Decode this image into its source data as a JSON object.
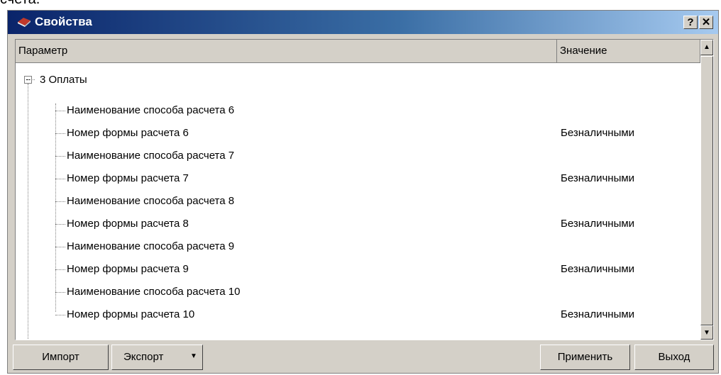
{
  "top_fragment": "счета.",
  "window": {
    "title": "Свойства"
  },
  "titlebar_buttons": {
    "help": "?",
    "close": "✕"
  },
  "columns": {
    "param": "Параметр",
    "value": "Значение"
  },
  "tree": {
    "root": "3 Оплаты",
    "rows": [
      {
        "name": "Наименование способа расчета 6",
        "value": ""
      },
      {
        "name": "Номер формы расчета 6",
        "value": "Безналичными"
      },
      {
        "name": "Наименование способа расчета 7",
        "value": ""
      },
      {
        "name": "Номер формы расчета 7",
        "value": "Безналичными"
      },
      {
        "name": "Наименование способа расчета 8",
        "value": ""
      },
      {
        "name": "Номер формы расчета 8",
        "value": "Безналичными"
      },
      {
        "name": "Наименование способа расчета 9",
        "value": ""
      },
      {
        "name": "Номер формы расчета 9",
        "value": "Безналичными"
      },
      {
        "name": "Наименование способа расчета 10",
        "value": ""
      },
      {
        "name": "Номер формы расчета 10",
        "value": "Безналичными"
      }
    ]
  },
  "buttons": {
    "import": "Импорт",
    "export": "Экспорт",
    "apply": "Применить",
    "exit": "Выход"
  },
  "icons": {
    "scroll_up": "▲",
    "scroll_down": "▼",
    "dropdown": "▼"
  }
}
